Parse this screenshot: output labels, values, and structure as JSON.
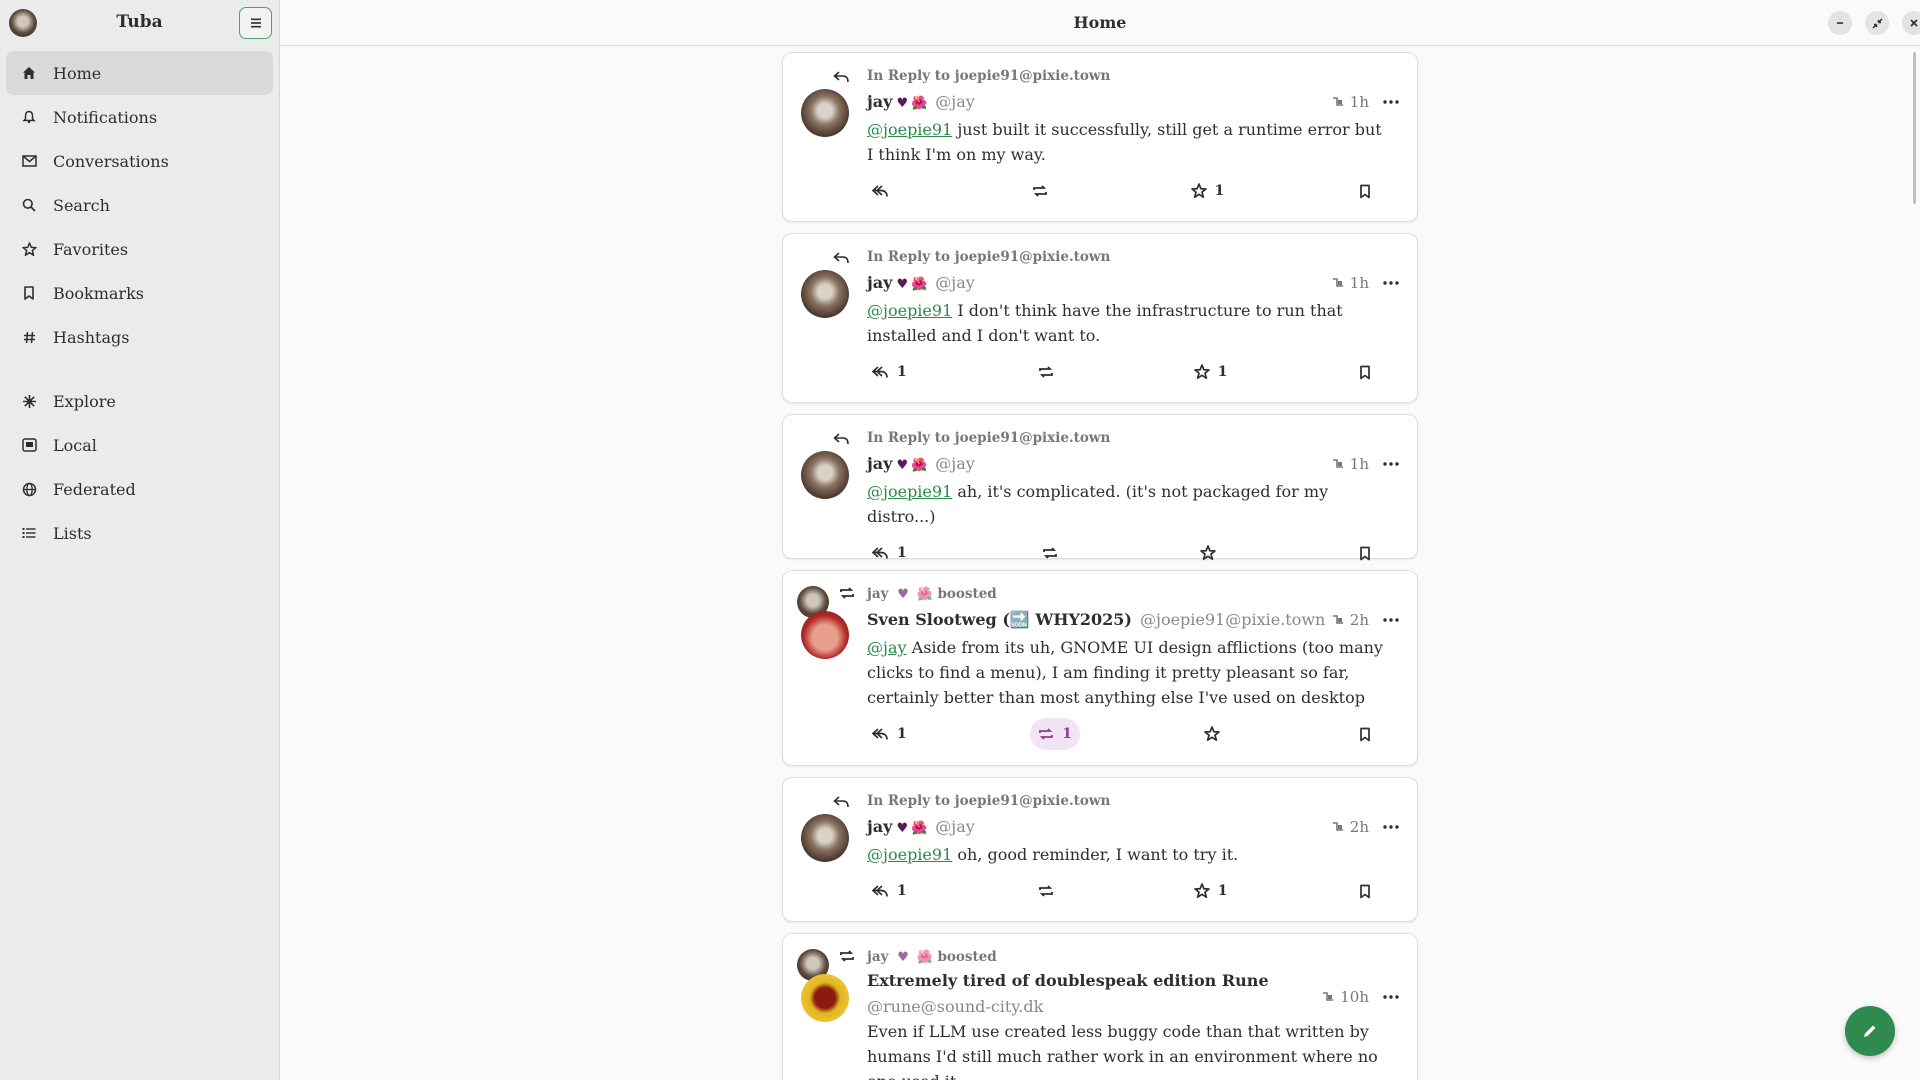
{
  "app": {
    "title": "Tuba"
  },
  "header": {
    "title": "Home"
  },
  "sidebar": {
    "items": [
      {
        "label": "Home",
        "icon": "home-icon",
        "active": true
      },
      {
        "label": "Notifications",
        "icon": "bell-icon"
      },
      {
        "label": "Conversations",
        "icon": "envelope-icon"
      },
      {
        "label": "Search",
        "icon": "search-icon"
      },
      {
        "label": "Favorites",
        "icon": "star-icon"
      },
      {
        "label": "Bookmarks",
        "icon": "bookmark-icon"
      },
      {
        "label": "Hashtags",
        "icon": "hash-icon"
      },
      {
        "label": "Explore",
        "icon": "explore-icon"
      },
      {
        "label": "Local",
        "icon": "local-icon"
      },
      {
        "label": "Federated",
        "icon": "globe-icon"
      },
      {
        "label": "Lists",
        "icon": "list-icon"
      }
    ]
  },
  "posts": [
    {
      "context": "In Reply to joepie91@pixie.town",
      "name": "jay",
      "handle": "@jay",
      "time": "1h",
      "mention": "@joepie91",
      "text": " just built it successfully, still get a runtime error but I think I'm on my way.",
      "replies": "",
      "boosts": "",
      "favs": "1"
    },
    {
      "context": "In Reply to joepie91@pixie.town",
      "name": "jay",
      "handle": "@jay",
      "time": "1h",
      "mention": "@joepie91",
      "text": " I don't think have the infrastructure to run that installed and I don't want to.",
      "replies": "1",
      "boosts": "",
      "favs": "1"
    },
    {
      "context": "In Reply to joepie91@pixie.town",
      "name": "jay",
      "handle": "@jay",
      "time": "1h",
      "mention": "@joepie91",
      "text": " ah, it's complicated. (it's not packaged for my distro...)",
      "replies": "1",
      "boosts": "",
      "favs": ""
    },
    {
      "context": "boosted",
      "booster": "jay",
      "name": "Sven Slootweg (🔜 WHY2025)",
      "handle": "@joepie91@pixie.town",
      "time": "2h",
      "mention": "@jay",
      "text": " Aside from its uh, GNOME UI design afflictions (too many clicks to find a menu), I am finding it pretty pleasant so far, certainly better than most anything else I've used on desktop",
      "replies": "1",
      "boosts": "1",
      "favs": ""
    },
    {
      "context": "In Reply to joepie91@pixie.town",
      "name": "jay",
      "handle": "@jay",
      "time": "2h",
      "mention": "@joepie91",
      "text": " oh, good reminder, I want to try it.",
      "replies": "1",
      "boosts": "",
      "favs": "1"
    },
    {
      "context": "boosted",
      "booster": "jay",
      "name": "Extremely tired of doublespeak edition Rune",
      "handle": "@rune@sound-city.dk",
      "time": "10h",
      "mention": "",
      "text": "Even if LLM use created less buggy code than that written by humans I'd still much rather work in an environment where no one used it."
    }
  ],
  "colors": {
    "accent": "#2e8a4e",
    "mention": "#2a8a4a",
    "boosted_bg": "#f3e4f3"
  }
}
